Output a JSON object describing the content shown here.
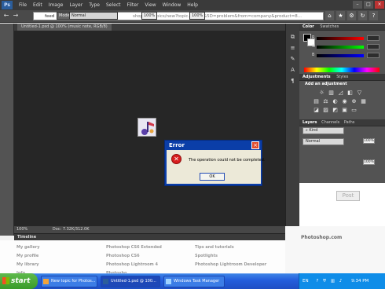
{
  "app": {
    "logo": "Ps"
  },
  "menu": [
    "File",
    "Edit",
    "Image",
    "Layer",
    "Type",
    "Select",
    "Filter",
    "View",
    "Window",
    "Help"
  ],
  "address": {
    "text": "shop_fa...opics/new?topic...style%5D=problem&from=company&product=8...",
    "fragment_left": "feed"
  },
  "options": {
    "mode_label": "Mode:",
    "mode_value": "Normal",
    "opacity_value": "100%",
    "fill_value": "100%"
  },
  "document": {
    "tab_title": "Untitled-1.psd @ 100% (music note, RGB/8)",
    "zoom": "100%",
    "doc_info": "Doc: 7.32K/312.0K"
  },
  "panels": {
    "color_tab": "Color",
    "swatches_tab": "Swatches",
    "sliders": [
      {
        "label": "R",
        "value": "0"
      },
      {
        "label": "G",
        "value": "0"
      },
      {
        "label": "B",
        "value": "0"
      }
    ],
    "adjustments_tab": "Adjustments",
    "styles_tab": "Styles",
    "add_adjustment": "Add an adjustment",
    "layers_tab": "Layers",
    "channels_tab": "Channels",
    "paths_tab": "Paths",
    "kind_label": "Kind",
    "blend_mode": "Normal",
    "opacity": "100%",
    "fill": "100%"
  },
  "dialog": {
    "title": "Error",
    "message": "The operation could not be completed.",
    "ok": "OK"
  },
  "timeline": {
    "label": "Timeline"
  },
  "web": {
    "col1": [
      "My gallery",
      "My profile",
      "My library",
      "Info..."
    ],
    "col2": [
      "Photoshop CS6 Extended",
      "Photoshop CS6",
      "Photoshop Lightroom 4",
      "Photosho..."
    ],
    "col3": [
      "Tips and tutorials",
      "Spotlights",
      "Photoshop Lightroom Developer",
      ""
    ],
    "brand": "Photoshop.com",
    "post_button": "Post"
  },
  "taskbar": {
    "start": "start",
    "tasks": [
      "New topic for Photos...",
      "Untitled-1.psd @ 100...",
      "Windows Task Manager"
    ],
    "lang": "EN",
    "clock": "9:34 PM"
  },
  "colors": {
    "accent": "#245edc",
    "error": "#d81d1d",
    "dialog_frame": "#0b3ea8"
  }
}
